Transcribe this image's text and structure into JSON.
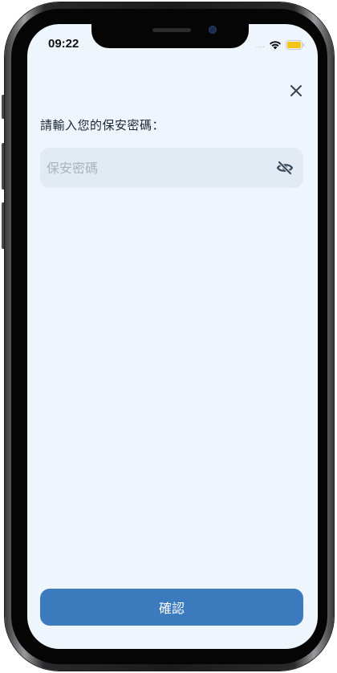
{
  "status_bar": {
    "time": "09:22",
    "signal_dots": "....",
    "wifi_icon": "wifi-icon",
    "battery_icon": "battery-icon",
    "battery_color": "#f5c518"
  },
  "dialog": {
    "close_icon": "close-icon",
    "prompt": "請輸入您的保安密碼：",
    "password_field": {
      "value": "",
      "placeholder": "保安密碼",
      "toggle_icon": "eye-slash-icon"
    },
    "confirm_label": "確認"
  },
  "colors": {
    "screen_background": "#eef5fc",
    "input_background": "#e2ebf3",
    "accent": "#3b7bbd",
    "text": "#1c2733",
    "placeholder": "#a8b4bf"
  }
}
